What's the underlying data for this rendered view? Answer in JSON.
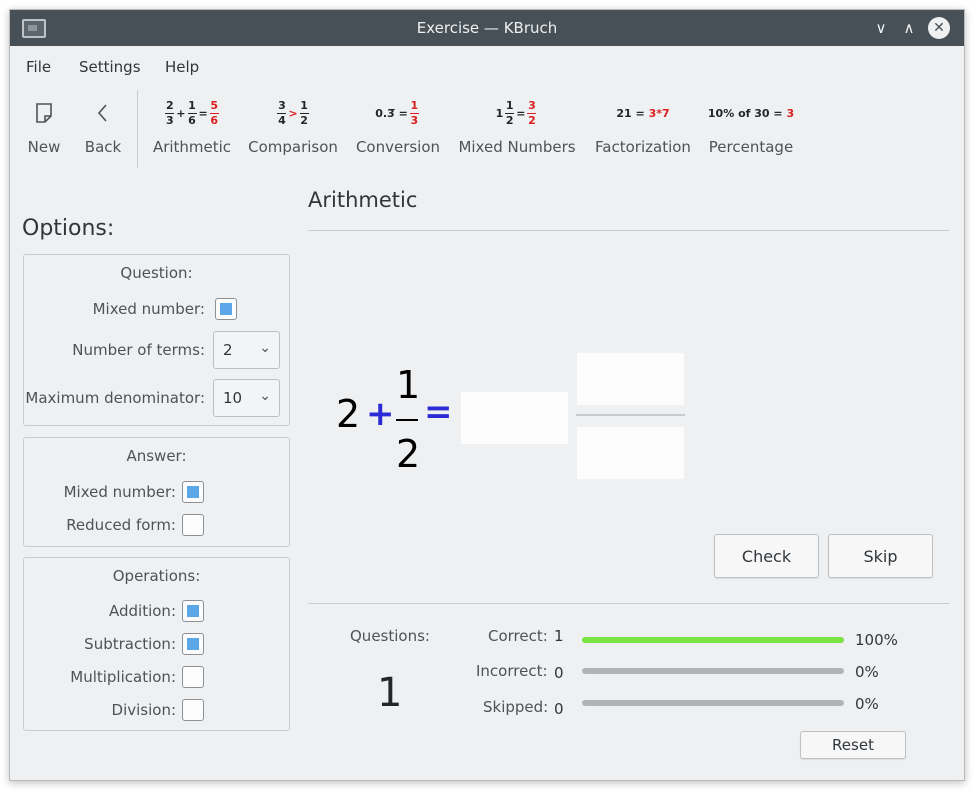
{
  "window": {
    "title": "Exercise — KBruch"
  },
  "titlebar": {
    "minimize_glyph": "∨",
    "maximize_glyph": "∧",
    "close_glyph": "✕"
  },
  "menu": [
    "File",
    "Settings",
    "Help"
  ],
  "toolbar": {
    "new": {
      "label": "New",
      "icon": "new-document-icon"
    },
    "back": {
      "label": "Back",
      "icon": "back-arrow-icon"
    },
    "modes": [
      {
        "label": "Arithmetic"
      },
      {
        "label": "Comparison"
      },
      {
        "label": "Conversion"
      },
      {
        "label": "Mixed Numbers"
      },
      {
        "label": "Factorization"
      },
      {
        "label": "Percentage"
      }
    ],
    "icons": {
      "arithmetic": {
        "a_num": "2",
        "a_den": "3",
        "op": "+",
        "b_num": "1",
        "b_den": "6",
        "eq": "=",
        "r_num": "5",
        "r_den": "6"
      },
      "comparison": {
        "a_num": "3",
        "a_den": "4",
        "op": ">",
        "b_num": "1",
        "b_den": "2"
      },
      "conversion": {
        "decimal": "0.3̅",
        "eq": "=",
        "r_num": "1",
        "r_den": "3"
      },
      "mixed": {
        "whole": "1",
        "num": "1",
        "den": "2",
        "eq": "=",
        "r_num": "3",
        "r_den": "2"
      },
      "factorization": {
        "left": "21 =",
        "right": "3*7"
      },
      "percentage": {
        "left": "10% of 30 =",
        "right": "3"
      }
    }
  },
  "options": {
    "title": "Options:",
    "question": {
      "title": "Question:",
      "mixed_label": "Mixed number:",
      "mixed_checked": true,
      "terms_label": "Number of terms:",
      "terms_value": "2",
      "maxden_label": "Maximum denominator:",
      "maxden_value": "10"
    },
    "answer": {
      "title": "Answer:",
      "mixed_label": "Mixed number:",
      "mixed_checked": true,
      "reduced_label": "Reduced form:",
      "reduced_checked": false
    },
    "operations": {
      "title": "Operations:",
      "addition_label": "Addition:",
      "addition_checked": true,
      "subtraction_label": "Subtraction:",
      "subtraction_checked": true,
      "multiplication_label": "Multiplication:",
      "multiplication_checked": false,
      "division_label": "Division:",
      "division_checked": false
    }
  },
  "exercise": {
    "title": "Arithmetic",
    "whole": "2",
    "operator": "+",
    "numerator": "1",
    "denominator": "2",
    "equals": "=",
    "check_label": "Check",
    "skip_label": "Skip"
  },
  "stats": {
    "questions_label": "Questions:",
    "questions_count": "1",
    "correct_label": "Correct:",
    "correct_value": "1",
    "correct_pct": "100%",
    "correct_fraction": 1.0,
    "incorrect_label": "Incorrect:",
    "incorrect_value": "0",
    "incorrect_pct": "0%",
    "incorrect_fraction": 0.0,
    "skipped_label": "Skipped:",
    "skipped_value": "0",
    "skipped_pct": "0%",
    "skipped_fraction": 0.0,
    "reset_label": "Reset"
  },
  "colors": {
    "accent": "#3daee9",
    "checkbox": "#5ba7e8",
    "progress": "#7ae442",
    "red_result": "#da2020",
    "operator_blue": "#2b2bd6",
    "titlebar": "#475057"
  }
}
